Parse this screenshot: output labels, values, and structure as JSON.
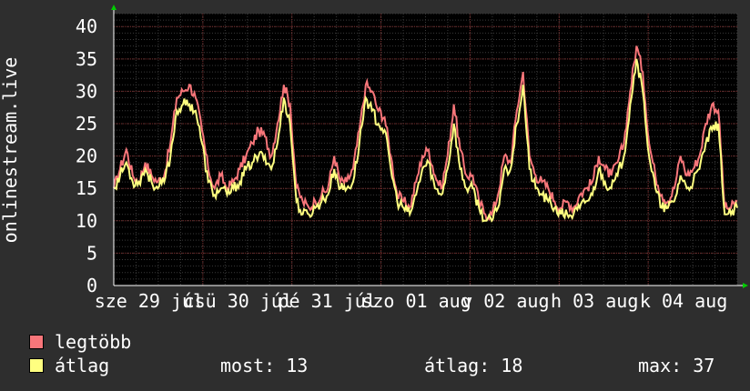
{
  "chart_data": {
    "type": "line",
    "ylabel": "onlinestream.live",
    "ylim": [
      0,
      42
    ],
    "yticks": [
      "0",
      "5",
      "10",
      "15",
      "20",
      "25",
      "30",
      "35",
      "40"
    ],
    "xticks": [
      "sze 29 júl",
      "csü 30 júl",
      "pé 31 júl",
      "szo 01 aug",
      "v 02 aug",
      "h 03 aug",
      "k 04 aug"
    ],
    "grid": true,
    "colors": {
      "background": "#2e2e2e",
      "plot": "#000000",
      "grid": "#505050",
      "legtobb": "#f8767a",
      "atlag": "#ffff80",
      "axis": "#ffffff",
      "arrow": "#00cc00"
    },
    "series": [
      {
        "name": "legtöbb",
        "color": "#f8767a",
        "anchors": [
          [
            0,
            15
          ],
          [
            1,
            18
          ],
          [
            2,
            21
          ],
          [
            3,
            17
          ],
          [
            4,
            16
          ],
          [
            5,
            19
          ],
          [
            6,
            17
          ],
          [
            7,
            16
          ],
          [
            8,
            17
          ],
          [
            9,
            22
          ],
          [
            10,
            29
          ],
          [
            11,
            30
          ],
          [
            12,
            31
          ],
          [
            13,
            29
          ],
          [
            14,
            24
          ],
          [
            15,
            18
          ],
          [
            16,
            15
          ],
          [
            17,
            17
          ],
          [
            18,
            15
          ],
          [
            19,
            16
          ],
          [
            20,
            18
          ],
          [
            21,
            20
          ],
          [
            22,
            22
          ],
          [
            23,
            24
          ],
          [
            24,
            23
          ],
          [
            25,
            20
          ],
          [
            26,
            25
          ],
          [
            27,
            31
          ],
          [
            28,
            28
          ],
          [
            29,
            15
          ],
          [
            30,
            13
          ],
          [
            31,
            12
          ],
          [
            32,
            13
          ],
          [
            33,
            14
          ],
          [
            34,
            15
          ],
          [
            35,
            20
          ],
          [
            36,
            16
          ],
          [
            37,
            16
          ],
          [
            38,
            18
          ],
          [
            39,
            24
          ],
          [
            40,
            31
          ],
          [
            41,
            30
          ],
          [
            42,
            27
          ],
          [
            43,
            26
          ],
          [
            44,
            20
          ],
          [
            45,
            14
          ],
          [
            46,
            13
          ],
          [
            47,
            12
          ],
          [
            48,
            16
          ],
          [
            49,
            20
          ],
          [
            50,
            21
          ],
          [
            51,
            17
          ],
          [
            52,
            15
          ],
          [
            53,
            20
          ],
          [
            54,
            28
          ],
          [
            55,
            21
          ],
          [
            56,
            17
          ],
          [
            57,
            17
          ],
          [
            58,
            13
          ],
          [
            59,
            11
          ],
          [
            60,
            11
          ],
          [
            61,
            14
          ],
          [
            62,
            20
          ],
          [
            63,
            19
          ],
          [
            64,
            27
          ],
          [
            65,
            33
          ],
          [
            66,
            20
          ],
          [
            67,
            17
          ],
          [
            68,
            16
          ],
          [
            69,
            15
          ],
          [
            70,
            13
          ],
          [
            71,
            12
          ],
          [
            72,
            13
          ],
          [
            73,
            12
          ],
          [
            74,
            14
          ],
          [
            75,
            15
          ],
          [
            76,
            16
          ],
          [
            77,
            20
          ],
          [
            78,
            18
          ],
          [
            79,
            17
          ],
          [
            80,
            19
          ],
          [
            81,
            22
          ],
          [
            82,
            30
          ],
          [
            83,
            37
          ],
          [
            84,
            33
          ],
          [
            85,
            22
          ],
          [
            86,
            17
          ],
          [
            87,
            14
          ],
          [
            88,
            13
          ],
          [
            89,
            15
          ],
          [
            90,
            20
          ],
          [
            91,
            17
          ],
          [
            92,
            18
          ],
          [
            93,
            20
          ],
          [
            94,
            25
          ],
          [
            95,
            28
          ],
          [
            96,
            27
          ],
          [
            97,
            12
          ],
          [
            98,
            12
          ],
          [
            99,
            13
          ]
        ]
      },
      {
        "name": "átlag",
        "color": "#ffff80",
        "anchors": [
          [
            0,
            15
          ],
          [
            1,
            17
          ],
          [
            2,
            19
          ],
          [
            3,
            16
          ],
          [
            4,
            16
          ],
          [
            5,
            18
          ],
          [
            6,
            16
          ],
          [
            7,
            15
          ],
          [
            8,
            16
          ],
          [
            9,
            20
          ],
          [
            10,
            27
          ],
          [
            11,
            28
          ],
          [
            12,
            28
          ],
          [
            13,
            27
          ],
          [
            14,
            22
          ],
          [
            15,
            16
          ],
          [
            16,
            14
          ],
          [
            17,
            15
          ],
          [
            18,
            14
          ],
          [
            19,
            15
          ],
          [
            20,
            16
          ],
          [
            21,
            18
          ],
          [
            22,
            19
          ],
          [
            23,
            20
          ],
          [
            24,
            20
          ],
          [
            25,
            18
          ],
          [
            26,
            22
          ],
          [
            27,
            29
          ],
          [
            28,
            25
          ],
          [
            29,
            13
          ],
          [
            30,
            11
          ],
          [
            31,
            11
          ],
          [
            32,
            12
          ],
          [
            33,
            13
          ],
          [
            34,
            14
          ],
          [
            35,
            18
          ],
          [
            36,
            15
          ],
          [
            37,
            15
          ],
          [
            38,
            16
          ],
          [
            39,
            22
          ],
          [
            40,
            29
          ],
          [
            41,
            27
          ],
          [
            42,
            25
          ],
          [
            43,
            24
          ],
          [
            44,
            18
          ],
          [
            45,
            13
          ],
          [
            46,
            12
          ],
          [
            47,
            11
          ],
          [
            48,
            14
          ],
          [
            49,
            18
          ],
          [
            50,
            19
          ],
          [
            51,
            15
          ],
          [
            52,
            14
          ],
          [
            53,
            18
          ],
          [
            54,
            25
          ],
          [
            55,
            18
          ],
          [
            56,
            15
          ],
          [
            57,
            15
          ],
          [
            58,
            12
          ],
          [
            59,
            10
          ],
          [
            60,
            10
          ],
          [
            61,
            12
          ],
          [
            62,
            18
          ],
          [
            63,
            18
          ],
          [
            64,
            25
          ],
          [
            65,
            31
          ],
          [
            66,
            18
          ],
          [
            67,
            15
          ],
          [
            68,
            14
          ],
          [
            69,
            13
          ],
          [
            70,
            12
          ],
          [
            71,
            11
          ],
          [
            72,
            11
          ],
          [
            73,
            11
          ],
          [
            74,
            12
          ],
          [
            75,
            13
          ],
          [
            76,
            14
          ],
          [
            77,
            18
          ],
          [
            78,
            16
          ],
          [
            79,
            15
          ],
          [
            80,
            17
          ],
          [
            81,
            20
          ],
          [
            82,
            28
          ],
          [
            83,
            35
          ],
          [
            84,
            30
          ],
          [
            85,
            20
          ],
          [
            86,
            15
          ],
          [
            87,
            12
          ],
          [
            88,
            12
          ],
          [
            89,
            13
          ],
          [
            90,
            17
          ],
          [
            91,
            15
          ],
          [
            92,
            16
          ],
          [
            93,
            18
          ],
          [
            94,
            22
          ],
          [
            95,
            24
          ],
          [
            96,
            25
          ],
          [
            97,
            11
          ],
          [
            98,
            11
          ],
          [
            99,
            12
          ]
        ]
      }
    ]
  },
  "legend": {
    "items": [
      {
        "label": "legtöbb",
        "color": "#f8767a"
      },
      {
        "label": "átlag",
        "color": "#ffff80"
      }
    ]
  },
  "stats": {
    "most": "most: 13",
    "atlag": "átlag: 18",
    "max": "max: 37"
  }
}
